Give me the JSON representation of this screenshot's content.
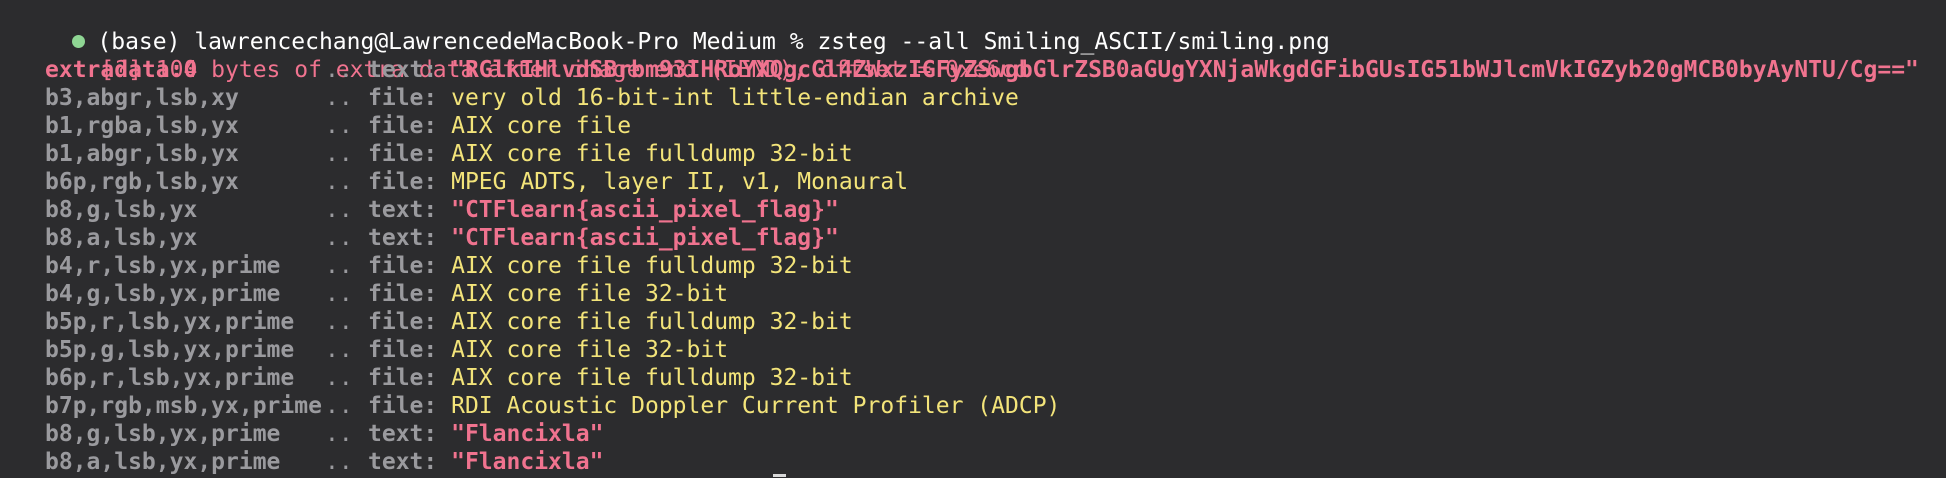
{
  "prompt": {
    "text": "(base) lawrencechang@LawrencedeMacBook-Pro Medium % zsteg --all Smiling_ASCII/smiling.png"
  },
  "warning": "[?] 104 bytes of extra data after image end (IEND), offset = 0xe6cd",
  "separator": "..",
  "rows": [
    {
      "label": "extradata:0",
      "kind": "text:",
      "value": "\"RGlkIHlvdSBrbm93IHRoYXQgcGl4ZWxzIGFyZSwgbGlrZSB0aGUgYXNjaWkgdGFibGUsIG51bWJlcmVkIGZyb20gMCB0byAyNTU/Cg==\"",
      "highlight": true,
      "type": "text"
    },
    {
      "label": "b3,abgr,lsb,xy",
      "kind": "file:",
      "value": "very old 16-bit-int little-endian archive",
      "highlight": false,
      "type": "file"
    },
    {
      "label": "b1,rgba,lsb,yx",
      "kind": "file:",
      "value": "AIX core file",
      "highlight": false,
      "type": "file"
    },
    {
      "label": "b1,abgr,lsb,yx",
      "kind": "file:",
      "value": "AIX core file fulldump 32-bit",
      "highlight": false,
      "type": "file"
    },
    {
      "label": "b6p,rgb,lsb,yx",
      "kind": "file:",
      "value": "MPEG ADTS, layer II, v1, Monaural",
      "highlight": false,
      "type": "file"
    },
    {
      "label": "b8,g,lsb,yx",
      "kind": "text:",
      "value": "\"CTFlearn{ascii_pixel_flag}\"",
      "highlight": false,
      "type": "text"
    },
    {
      "label": "b8,a,lsb,yx",
      "kind": "text:",
      "value": "\"CTFlearn{ascii_pixel_flag}\"",
      "highlight": false,
      "type": "text"
    },
    {
      "label": "b4,r,lsb,yx,prime",
      "kind": "file:",
      "value": "AIX core file fulldump 32-bit",
      "highlight": false,
      "type": "file"
    },
    {
      "label": "b4,g,lsb,yx,prime",
      "kind": "file:",
      "value": "AIX core file 32-bit",
      "highlight": false,
      "type": "file"
    },
    {
      "label": "b5p,r,lsb,yx,prime",
      "kind": "file:",
      "value": "AIX core file fulldump 32-bit",
      "highlight": false,
      "type": "file"
    },
    {
      "label": "b5p,g,lsb,yx,prime",
      "kind": "file:",
      "value": "AIX core file 32-bit",
      "highlight": false,
      "type": "file"
    },
    {
      "label": "b6p,r,lsb,yx,prime",
      "kind": "file:",
      "value": "AIX core file fulldump 32-bit",
      "highlight": false,
      "type": "file"
    },
    {
      "label": "b7p,rgb,msb,yx,prime",
      "kind": "file:",
      "value": "RDI Acoustic Doppler Current Profiler (ADCP)",
      "highlight": false,
      "type": "file"
    },
    {
      "label": "b8,g,lsb,yx,prime",
      "kind": "text:",
      "value": "\"Flancixla\"",
      "highlight": false,
      "type": "text"
    },
    {
      "label": "b8,a,lsb,yx,prime",
      "kind": "text:",
      "value": "\"Flancixla\"",
      "highlight": false,
      "type": "text"
    }
  ],
  "colors": {
    "background": "#2c2c2e",
    "prompt_dot": "#8fd694",
    "pink": "#f0738f",
    "yellow": "#f3e47a",
    "gray": "#9a9a9e"
  }
}
